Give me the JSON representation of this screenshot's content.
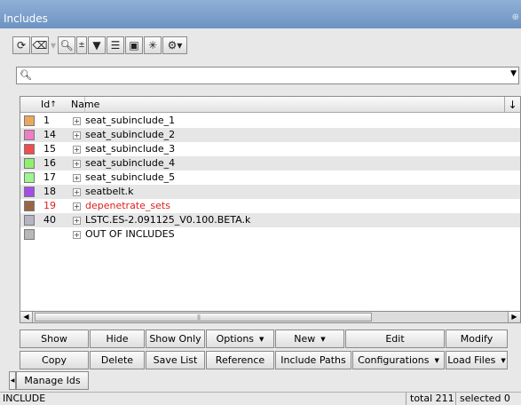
{
  "window": {
    "title": "Includes"
  },
  "toolbar": {
    "icons": [
      "refresh-icon",
      "eraser-icon",
      "zoom-icon",
      "expand-collapse-icon",
      "filter-icon",
      "list-icon",
      "card-icon",
      "explode-icon",
      "settings-icon"
    ]
  },
  "search": {
    "value": ""
  },
  "table": {
    "columns": {
      "id": "Id",
      "name": "Name"
    },
    "rows": [
      {
        "id": "1",
        "name": "seat_subinclude_1",
        "color": "#e8a95e"
      },
      {
        "id": "14",
        "name": "seat_subinclude_2",
        "color": "#ee7ec4"
      },
      {
        "id": "15",
        "name": "seat_subinclude_3",
        "color": "#ee4e4e"
      },
      {
        "id": "16",
        "name": "seat_subinclude_4",
        "color": "#8ef06e"
      },
      {
        "id": "17",
        "name": "seat_subinclude_5",
        "color": "#9ef592"
      },
      {
        "id": "18",
        "name": "seatbelt.k",
        "color": "#a24ee8"
      },
      {
        "id": "19",
        "name": "depenetrate_sets",
        "color": "#9a6544",
        "highlight": "#e02020"
      },
      {
        "id": "40",
        "name": "LSTC.ES-2.091125_V0.100.BETA.k",
        "color": "#b4b4c2"
      },
      {
        "id": "",
        "name": "OUT OF INCLUDES",
        "color": "#b8b8b8"
      }
    ]
  },
  "buttons": {
    "row1": [
      {
        "label": "Show"
      },
      {
        "label": "Hide"
      },
      {
        "label": "Show Only"
      },
      {
        "label": "Options",
        "dropdown": true
      },
      {
        "label": "New",
        "dropdown": true
      },
      {
        "label": "Edit"
      },
      {
        "label": "Modify"
      }
    ],
    "row2": [
      {
        "label": "Copy"
      },
      {
        "label": "Delete"
      },
      {
        "label": "Save List"
      },
      {
        "label": "Reference"
      },
      {
        "label": "Include Paths"
      },
      {
        "label": "Configurations",
        "dropdown": true
      },
      {
        "label": "Load Files",
        "dropdown": true
      }
    ],
    "manage_ids": "Manage Ids"
  },
  "status": {
    "mode": "INCLUDE",
    "total": "total 211",
    "selected": "selected 0"
  }
}
